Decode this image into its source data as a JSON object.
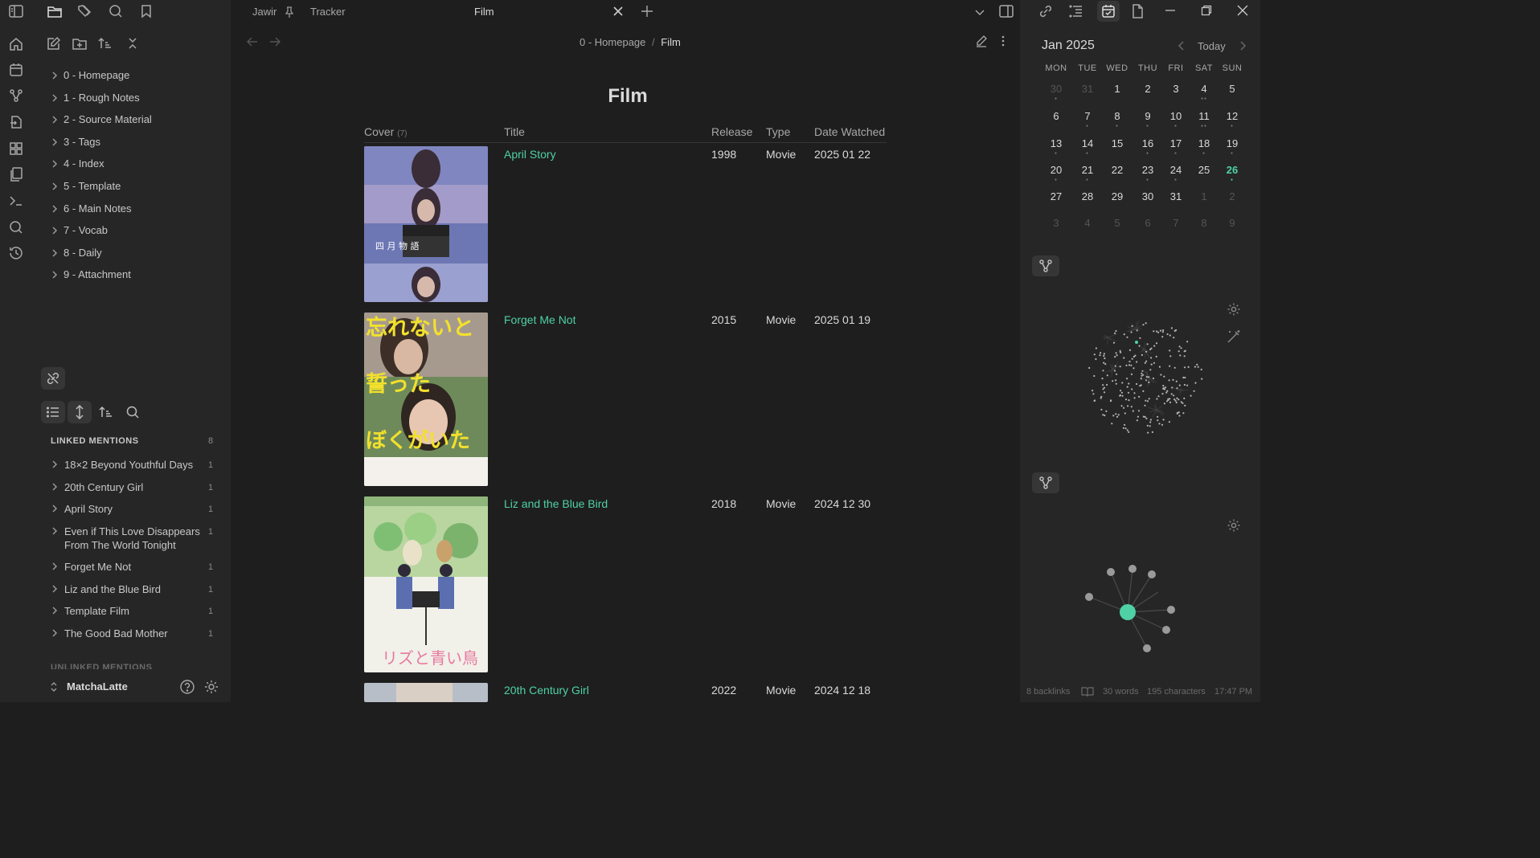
{
  "ribbon": {
    "icons": [
      "sidebar-toggle-icon",
      "home-icon",
      "calendar-icon",
      "graph-icon",
      "import-icon",
      "dashboard-icon",
      "files-icon",
      "terminal-icon",
      "search-icon",
      "history-icon"
    ]
  },
  "sidebar": {
    "file_tree": [
      "0 - Homepage",
      "1 - Rough Notes",
      "2 - Source Material",
      "3 - Tags",
      "4 - Index",
      "5 - Template",
      "6 - Main Notes",
      "7 - Vocab",
      "8 - Daily",
      "9 - Attachment"
    ],
    "linked_mentions": {
      "header": "LINKED MENTIONS",
      "count": "8",
      "items": [
        {
          "label": "18×2 Beyond Youthful Days",
          "count": "1"
        },
        {
          "label": "20th Century Girl",
          "count": "1"
        },
        {
          "label": "April Story",
          "count": "1"
        },
        {
          "label": "Even if This Love Disappears From The World Tonight",
          "count": "1"
        },
        {
          "label": "Forget Me Not",
          "count": "1"
        },
        {
          "label": "Liz and the Blue Bird",
          "count": "1"
        },
        {
          "label": "Template Film",
          "count": "1"
        },
        {
          "label": "The Good Bad Mother",
          "count": "1"
        }
      ]
    },
    "unlinked_header": "UNLINKED MENTIONS",
    "vault_name": "MatchaLatte"
  },
  "tabs": [
    {
      "label": "Jawir"
    },
    {
      "label": "Tracker"
    },
    {
      "label": "Film"
    }
  ],
  "breadcrumb": {
    "parent": "0 - Homepage",
    "separator": "/",
    "current": "Film"
  },
  "note": {
    "title": "Film",
    "columns": {
      "cover": "Cover",
      "cover_count": "(7)",
      "title": "Title",
      "release": "Release",
      "type": "Type",
      "date": "Date Watched"
    },
    "rows": [
      {
        "title": "April Story",
        "release": "1998",
        "type": "Movie",
        "date": "2025 01 22",
        "poster_text": "四 月 物 語"
      },
      {
        "title": "Forget Me Not",
        "release": "2015",
        "type": "Movie",
        "date": "2025 01 19",
        "poster_text": "忘れないと誓ったぼくがいた"
      },
      {
        "title": "Liz and the Blue Bird",
        "release": "2018",
        "type": "Movie",
        "date": "2024 12 30",
        "poster_text": "リズと青い鳥"
      },
      {
        "title": "20th Century Girl",
        "release": "2022",
        "type": "Movie",
        "date": "2024 12 18"
      }
    ]
  },
  "calendar": {
    "month": "Jan 2025",
    "today_label": "Today",
    "weekdays": [
      "MON",
      "TUE",
      "WED",
      "THU",
      "FRI",
      "SAT",
      "SUN"
    ],
    "weeks": [
      [
        "30",
        "31",
        "1",
        "2",
        "3",
        "4",
        "5"
      ],
      [
        "6",
        "7",
        "8",
        "9",
        "10",
        "11",
        "12"
      ],
      [
        "13",
        "14",
        "15",
        "16",
        "17",
        "18",
        "19"
      ],
      [
        "20",
        "21",
        "22",
        "23",
        "24",
        "25",
        "26"
      ],
      [
        "27",
        "28",
        "29",
        "30",
        "31",
        "1",
        "2"
      ],
      [
        "3",
        "4",
        "5",
        "6",
        "7",
        "8",
        "9"
      ]
    ],
    "today": "26",
    "accent": "#4fd1a5"
  },
  "status_bar": {
    "backlinks": "8 backlinks",
    "words": "30 words",
    "characters": "195 characters",
    "time": "17:47 PM"
  },
  "colors": {
    "accent": "#4fd1a5",
    "background": "#1e1e1e",
    "sidebar": "#262626"
  }
}
